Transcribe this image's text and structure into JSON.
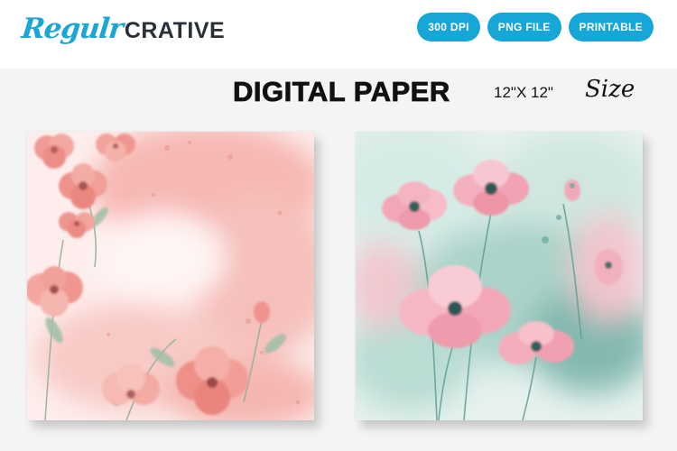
{
  "brand": {
    "script": "Regulr",
    "block": "CRATIVE"
  },
  "badges": [
    "300 DPI",
    "PNG FILE",
    "PRINTABLE"
  ],
  "headline": "DIGITAL PAPER",
  "size": {
    "dimensions": "12\"X 12\"",
    "label": "Size"
  },
  "papers": [
    {
      "name": "pink-watercolor-floral",
      "colors": [
        "#f7c6c2",
        "#ef8e8e",
        "#9bb7a5"
      ]
    },
    {
      "name": "mint-poppy-watercolor",
      "colors": [
        "#cfe6df",
        "#f4a9b8",
        "#5c9c95"
      ]
    }
  ]
}
